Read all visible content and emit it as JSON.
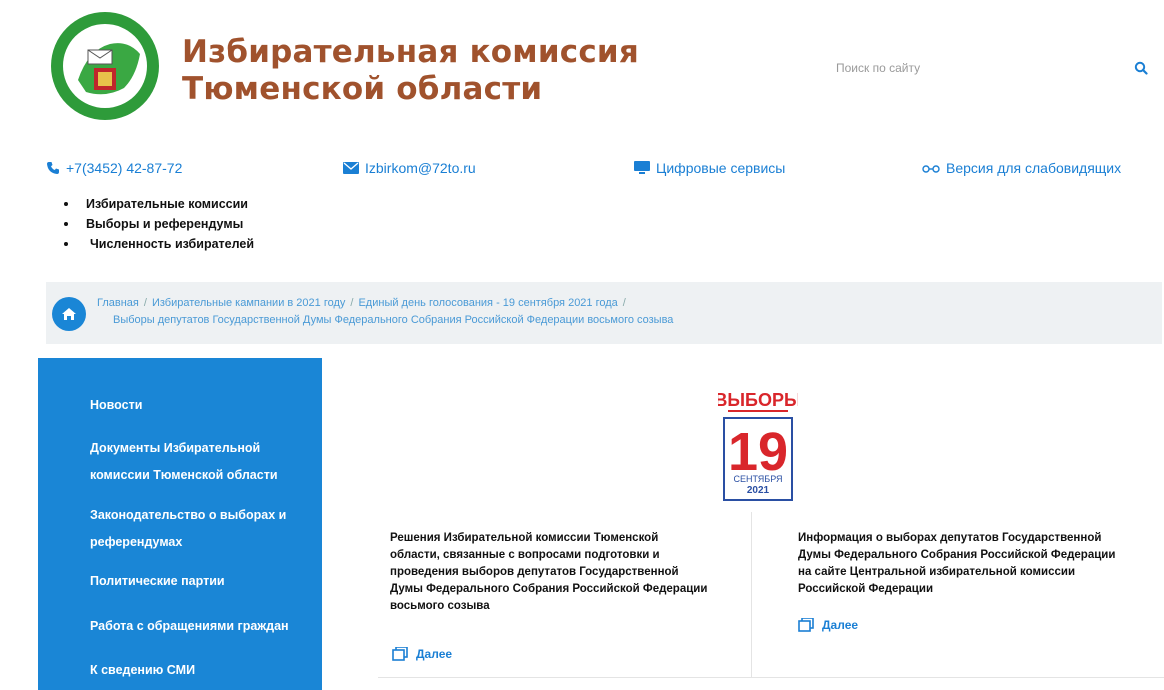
{
  "header": {
    "title_line1": "Избирательная комиссия",
    "title_line2": "Тюменской области",
    "search_placeholder": "Поиск по сайту"
  },
  "contacts": {
    "phone": "+7(3452) 42-87-72",
    "email": "Izbirkom@72to.ru",
    "digital": "Цифровые сервисы",
    "accessible": "Версия для слабовидящих"
  },
  "top_menu": [
    "Избирательные комиссии",
    "Выборы и референдумы",
    "Численность избирателей"
  ],
  "breadcrumb": {
    "home": "Главная",
    "item1": "Избирательные кампании в 2021 году",
    "item2": "Единый день голосования - 19 сентября 2021 года",
    "current": "Выборы депутатов Государственной Думы Федерального Собрания Российской Федерации восьмого созыва"
  },
  "sidebar": [
    "Новости",
    "Документы Избирательной",
    "комиссии Тюменской области",
    "Законодательство о выборах и",
    "референдумах",
    "Политические партии",
    "Работа с обращениями граждан",
    "К сведению СМИ"
  ],
  "election_logo": {
    "word": "ВЫБОРЫ",
    "day": "19",
    "month": "СЕНТЯБРЯ",
    "year": "2021"
  },
  "cards": [
    {
      "lines": [
        "Решения Избирательной комиссии Тюменской",
        "области, связанные с вопросами подготовки и",
        "проведения выборов депутатов Государственной",
        "Думы Федерального Собрания Российской Федерации",
        "восьмого созыва"
      ],
      "more": "Далее"
    },
    {
      "lines": [
        "Информация о выборах депутатов Государственной",
        "Думы Федерального Собрания Российской Федерации",
        "на сайте Центральной избирательной комиссии",
        "Российской Федерации"
      ],
      "more": "Далее"
    }
  ],
  "colors": {
    "brand_blue": "#1a86d6",
    "title_brown": "#a0522d",
    "election_red": "#d9262b"
  }
}
